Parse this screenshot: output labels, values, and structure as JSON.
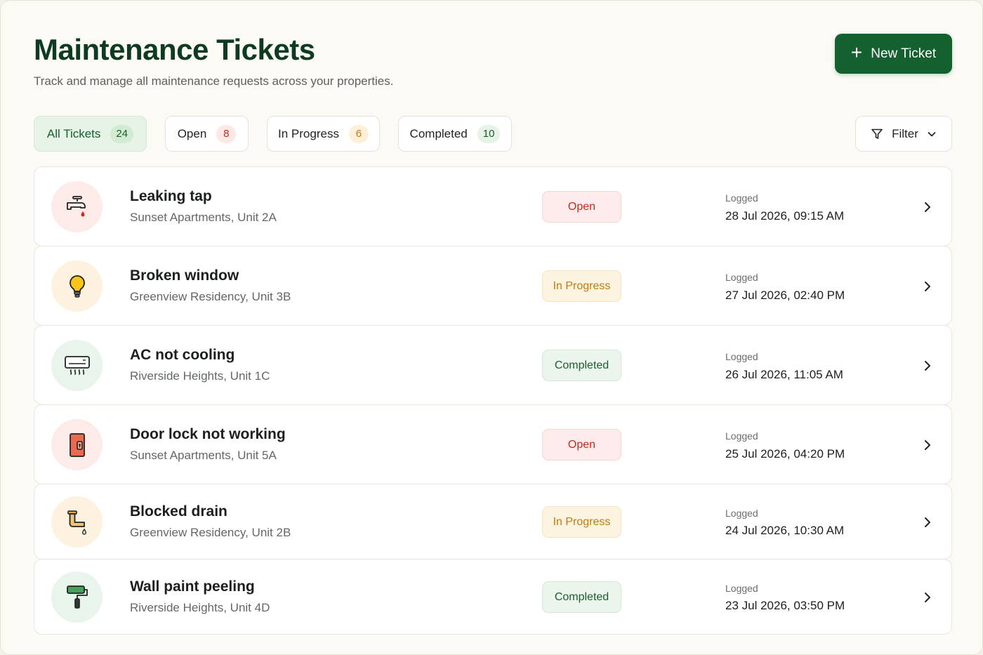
{
  "header": {
    "title": "Maintenance Tickets",
    "subtitle": "Track and manage all maintenance requests across your properties.",
    "new_ticket_label": "New Ticket"
  },
  "tabs": [
    {
      "label": "All Tickets",
      "count": "24",
      "active": true
    },
    {
      "label": "Open",
      "count": "8"
    },
    {
      "label": "In Progress",
      "count": "6"
    },
    {
      "label": "Completed",
      "count": "10"
    }
  ],
  "filter": {
    "label": "Filter"
  },
  "tickets": [
    {
      "title": "Leaking tap",
      "location": "Sunset Apartments, Unit 2A",
      "status": "Open",
      "logged_label": "Logged",
      "logged": "28 Jul 2026, 09:15 AM",
      "icon": "tap-icon"
    },
    {
      "title": "Broken window",
      "location": "Greenview Residency, Unit 3B",
      "status": "In Progress",
      "logged_label": "Logged",
      "logged": "27 Jul 2026, 02:40 PM",
      "icon": "lightbulb-icon"
    },
    {
      "title": "AC not cooling",
      "location": "Riverside Heights, Unit 1C",
      "status": "Completed",
      "logged_label": "Logged",
      "logged": "26 Jul 2026, 11:05 AM",
      "icon": "air-conditioner-icon"
    },
    {
      "title": "Door lock not working",
      "location": "Sunset Apartments, Unit 5A",
      "status": "Open",
      "logged_label": "Logged",
      "logged": "25 Jul 2026, 04:20 PM",
      "icon": "door-lock-icon"
    },
    {
      "title": "Blocked drain",
      "location": "Greenview Residency, Unit 2B",
      "status": "In Progress",
      "logged_label": "Logged",
      "logged": "24 Jul 2026, 10:30 AM",
      "icon": "drain-pipe-icon"
    },
    {
      "title": "Wall paint peeling",
      "location": "Riverside Heights, Unit 4D",
      "status": "Completed",
      "logged_label": "Logged",
      "logged": "23 Jul 2026, 03:50 PM",
      "icon": "paint-roller-icon"
    }
  ],
  "colors": {
    "brand": "#14612f",
    "open": "#c42a1e",
    "in_progress": "#c07b10",
    "completed": "#1b5c30"
  }
}
